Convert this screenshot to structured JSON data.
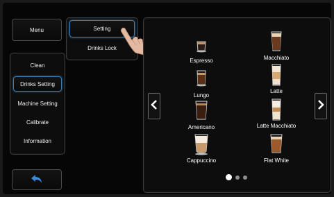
{
  "sidebar": {
    "menu_label": "Menu",
    "items": [
      {
        "label": "Clean"
      },
      {
        "label": "Drinks Setting"
      },
      {
        "label": "Machine Setting"
      },
      {
        "label": "Calibrate"
      },
      {
        "label": "Information"
      }
    ],
    "selected_item": "Drinks Setting",
    "back_icon": "return-arrow-icon"
  },
  "submenu": {
    "items": [
      {
        "label": "Setting"
      },
      {
        "label": "Drinks Lock"
      }
    ],
    "selected_item": "Setting",
    "pointer_icon": "hand-pointer-icon"
  },
  "drinks_grid": {
    "drinks": [
      {
        "name": "Espresso"
      },
      {
        "name": "Macchiato"
      },
      {
        "name": "Lungo"
      },
      {
        "name": "Latte"
      },
      {
        "name": "Americano"
      },
      {
        "name": "Latte Macchiato"
      },
      {
        "name": "Cappuccino"
      },
      {
        "name": "Flat White"
      }
    ],
    "prev_icon": "chevron-left-icon",
    "next_icon": "chevron-right-icon",
    "pagination": {
      "pages": 3,
      "current": 1
    }
  },
  "colors": {
    "background": "#060606",
    "border": "#3c3c3c",
    "selected_border": "#3a7fb6",
    "back_arrow": "#3b8ad8",
    "text": "#f0f0f0"
  }
}
